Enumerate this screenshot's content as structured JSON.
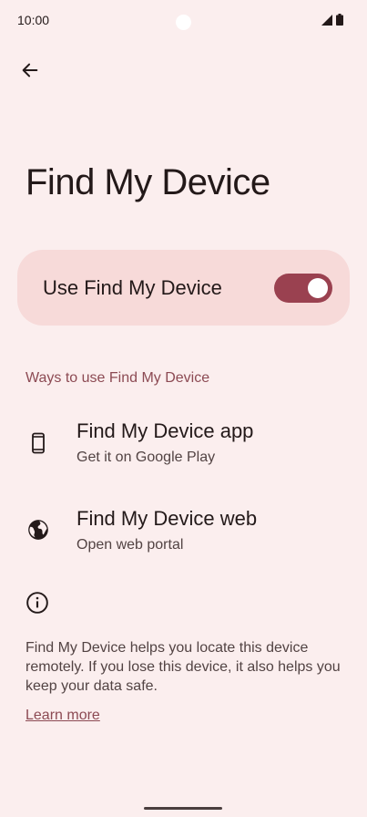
{
  "status_bar": {
    "time": "10:00",
    "icons": [
      "signal-icon",
      "battery-icon"
    ]
  },
  "header": {
    "back_icon": "arrow-back-icon",
    "title": "Find My Device"
  },
  "main_toggle": {
    "label": "Use Find My Device",
    "enabled": true
  },
  "section": {
    "header": "Ways to use Find My Device",
    "items": [
      {
        "icon": "phone-icon",
        "title": "Find My Device app",
        "subtitle": "Get it on Google Play"
      },
      {
        "icon": "globe-icon",
        "title": "Find My Device web",
        "subtitle": "Open web portal"
      }
    ]
  },
  "info": {
    "icon": "info-icon",
    "description": "Find My Device helps you locate this device remotely. If you lose this device, it also helps you keep your data safe.",
    "link": "Learn more"
  },
  "colors": {
    "background": "#FBEEEE",
    "card": "#F7DAD9",
    "accent": "#9A4150",
    "section_header": "#8C4A53"
  }
}
